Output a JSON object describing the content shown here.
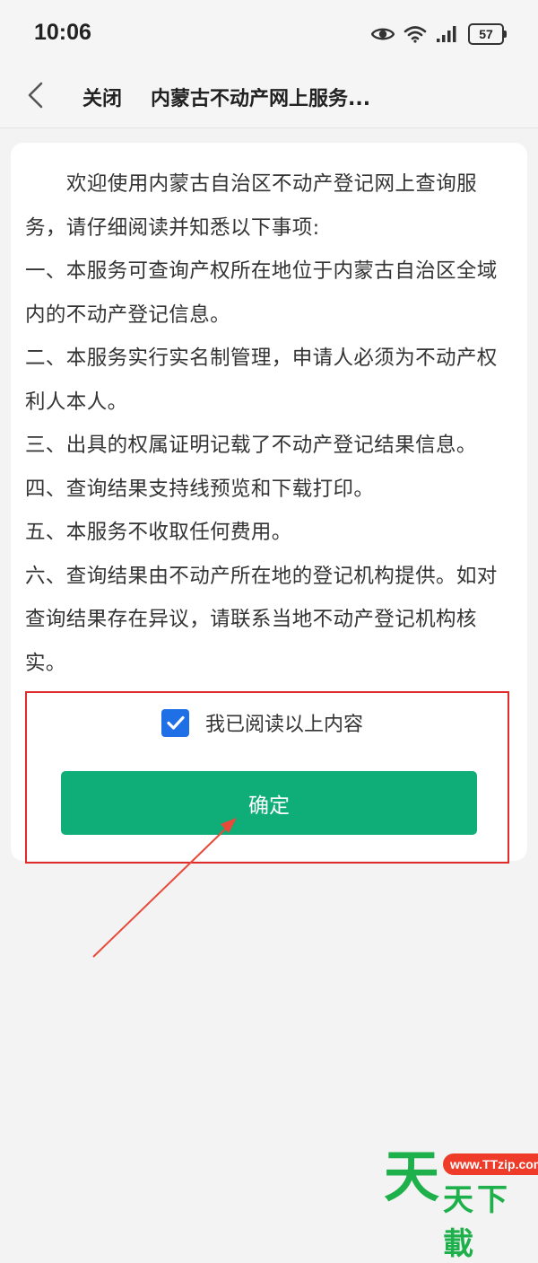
{
  "status_bar": {
    "time": "10:06",
    "battery": "57",
    "icons": [
      "eye-icon",
      "wifi-icon",
      "signal-icon",
      "battery-icon"
    ]
  },
  "nav": {
    "close_label": "关闭",
    "title": "内蒙古不动产网上服务..."
  },
  "notice": {
    "intro": "欢迎使用内蒙古自治区不动产登记网上查询服务，请仔细阅读并知悉以下事项:",
    "items": [
      "一、本服务可查询产权所在地位于内蒙古自治区全域内的不动产登记信息。",
      "二、本服务实行实名制管理，申请人必须为不动产权利人本人。",
      "三、出具的权属证明记载了不动产登记结果信息。",
      "四、查询结果支持线预览和下载打印。",
      "五、本服务不收取任何费用。",
      "六、查询结果由不动产所在地的登记机构提供。如对查询结果存在异议，请联系当地不动产登记机构核实。"
    ]
  },
  "agreement": {
    "checked": true,
    "label": "我已阅读以上内容"
  },
  "confirm_label": "确定",
  "watermark": {
    "big_char": "天",
    "url": "www.TTzip.com",
    "text": "天下載"
  },
  "colors": {
    "primary_green": "#0fae79",
    "checkbox_blue": "#1f6fe6",
    "highlight_red": "#e02b2b"
  }
}
